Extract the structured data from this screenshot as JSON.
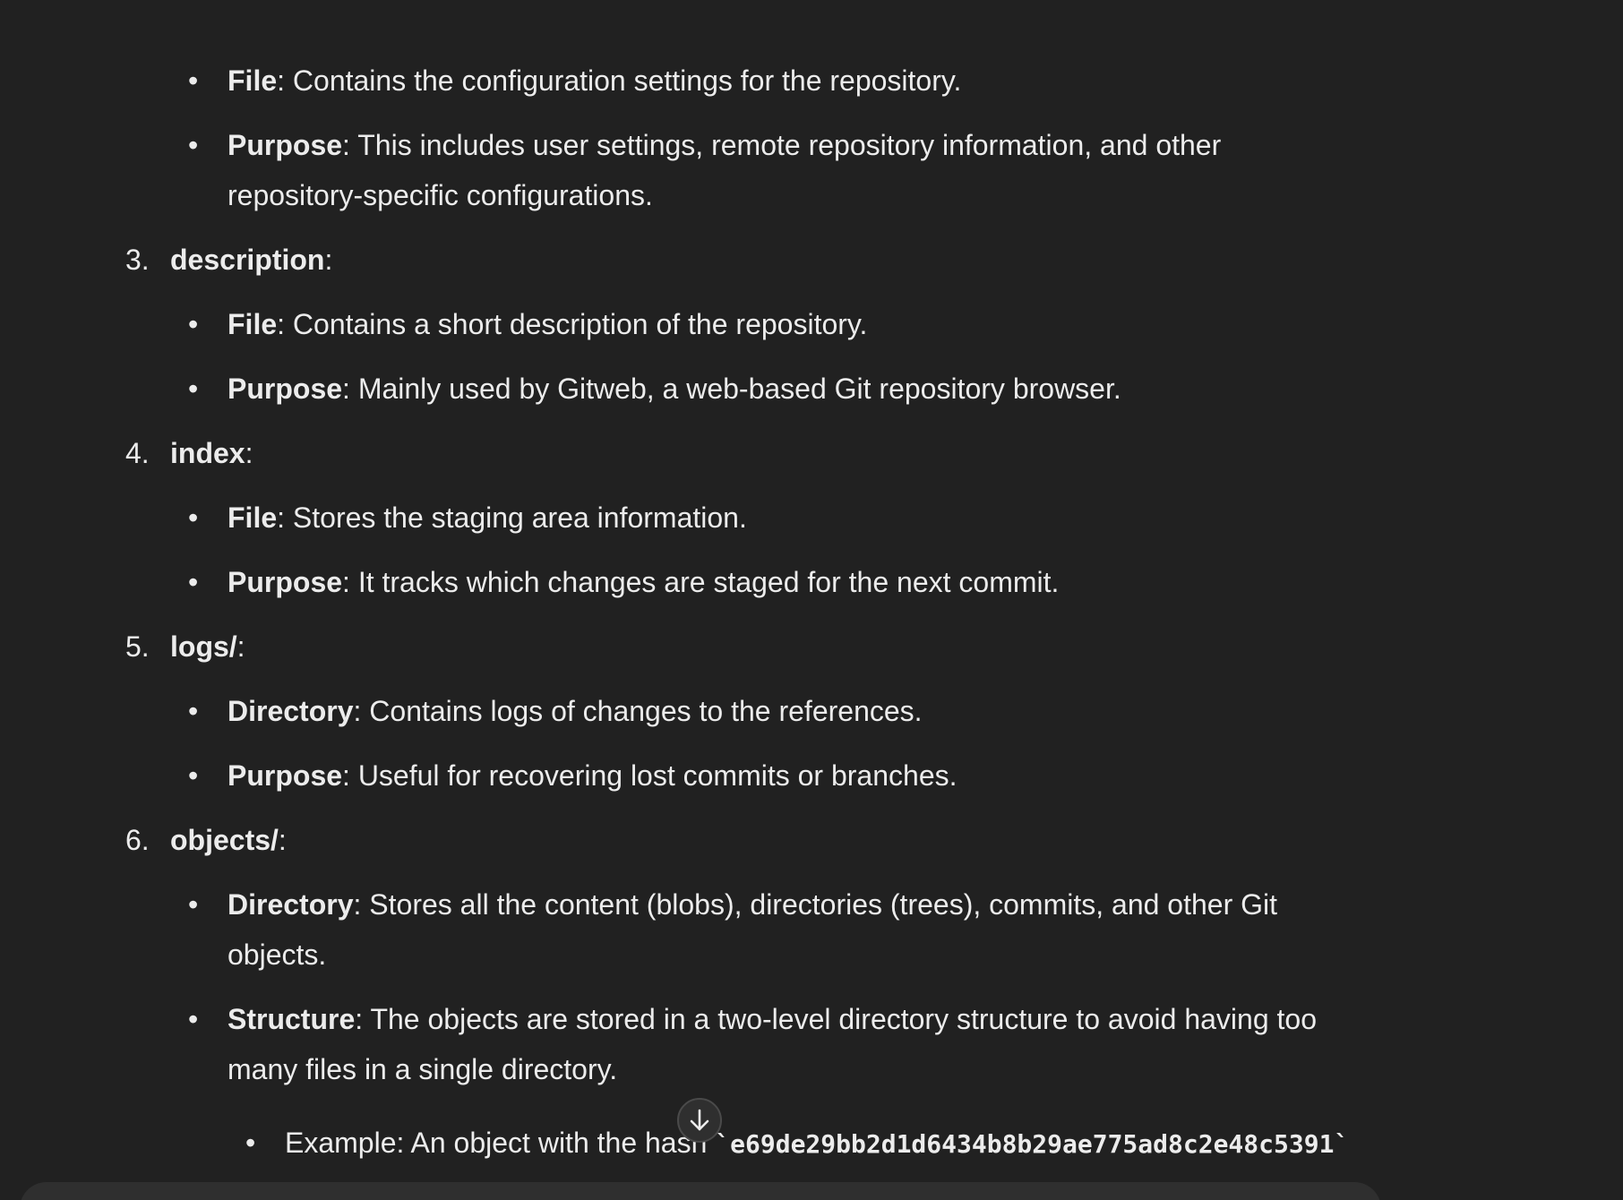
{
  "list": {
    "item2_bullets": [
      {
        "label": "File",
        "text": ": Contains the configuration settings for the repository."
      },
      {
        "label": "Purpose",
        "text": ": This includes user settings, remote repository information, and other",
        "cont": "repository-specific configurations."
      }
    ],
    "items": [
      {
        "num": "3.",
        "title": "description",
        "colon": ":",
        "bullets": [
          {
            "label": "File",
            "text": ": Contains a short description of the repository."
          },
          {
            "label": "Purpose",
            "text": ": Mainly used by Gitweb, a web-based Git repository browser."
          }
        ]
      },
      {
        "num": "4.",
        "title": "index",
        "colon": ":",
        "bullets": [
          {
            "label": "File",
            "text": ": Stores the staging area information."
          },
          {
            "label": "Purpose",
            "text": ": It tracks which changes are staged for the next commit."
          }
        ]
      },
      {
        "num": "5.",
        "title": "logs/",
        "colon": ":",
        "bullets": [
          {
            "label": "Directory",
            "text": ": Contains logs of changes to the references."
          },
          {
            "label": "Purpose",
            "text": ": Useful for recovering lost commits or branches."
          }
        ]
      },
      {
        "num": "6.",
        "title": "objects/",
        "colon": ":",
        "bullets": [
          {
            "label": "Directory",
            "text": ": Stores all the content (blobs), directories (trees), commits, and other Git",
            "cont": "objects."
          },
          {
            "label": "Structure",
            "text": ": The objects are stored in a two-level directory structure to avoid having too",
            "cont": "many files in a single directory."
          }
        ],
        "sub_bullet": {
          "text": "Example: An object with the hash ",
          "code": "`e69de29bb2d1d6434b8b29ae775ad8c2e48c5391`"
        }
      }
    ]
  },
  "scroll_button": {
    "icon": "arrow-down-icon"
  },
  "colors": {
    "background": "#212121",
    "text": "#ececec",
    "button_bg": "#2f2f2f"
  }
}
